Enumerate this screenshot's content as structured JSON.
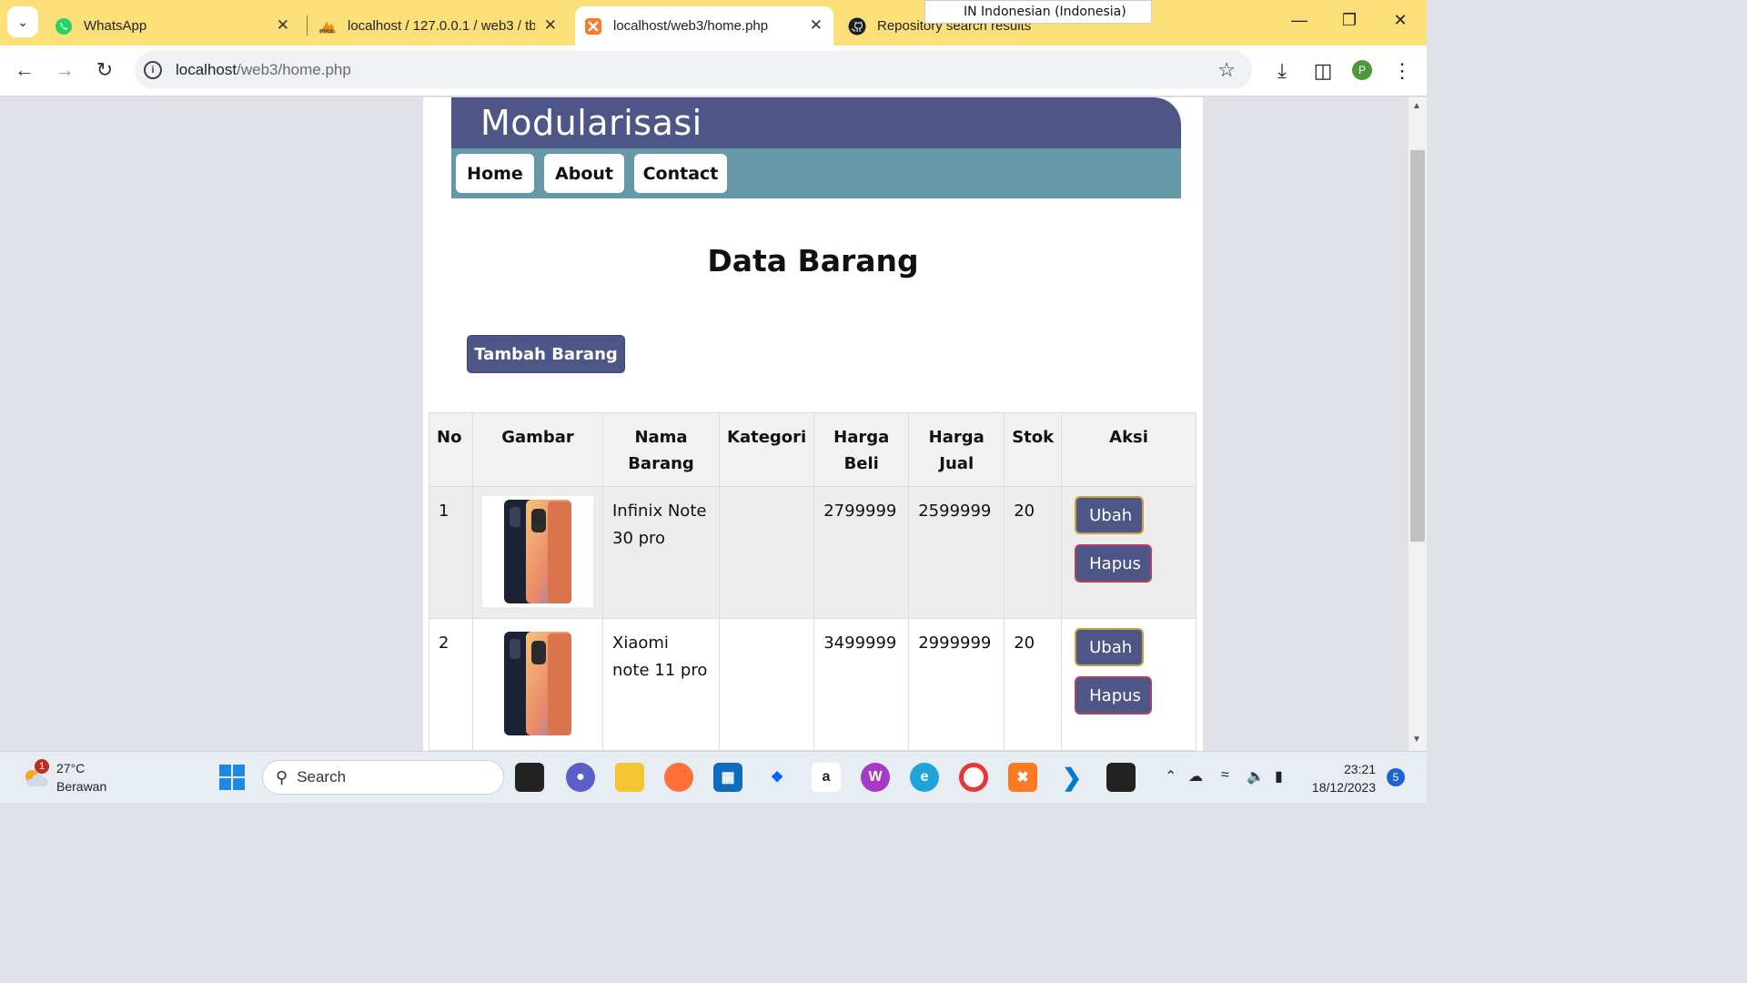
{
  "browser": {
    "tabs": [
      {
        "title": "WhatsApp",
        "icon": "whatsapp-icon"
      },
      {
        "title": "localhost / 127.0.0.1 / web3 / tb",
        "icon": "phpmyadmin-icon"
      },
      {
        "title": "localhost/web3/home.php",
        "icon": "xampp-icon",
        "active": true
      },
      {
        "title": "Repository search results",
        "icon": "github-icon"
      }
    ],
    "language_popup": "IN  Indonesian (Indonesia)",
    "url_host": "localhost",
    "url_path": "/web3/home.php",
    "profile_initial": "P"
  },
  "site": {
    "header_title": "Modularisasi",
    "nav": [
      "Home",
      "About",
      "Contact"
    ],
    "page_title": "Data Barang",
    "add_button": "Tambah Barang",
    "accent_color": "#4e5587",
    "nav_color": "#6699a8"
  },
  "table": {
    "headers": [
      "No",
      "Gambar",
      "Nama Barang",
      "Kategori",
      "Harga Beli",
      "Harga Jual",
      "Stok",
      "Aksi"
    ],
    "rows": [
      {
        "no": "1",
        "nama": "Infinix Note 30 pro",
        "kategori": "",
        "harga_beli": "2799999",
        "harga_jual": "2599999",
        "stok": "20"
      },
      {
        "no": "2",
        "nama": "Xiaomi note 11 pro",
        "kategori": "",
        "harga_beli": "3499999",
        "harga_jual": "2999999",
        "stok": "20"
      }
    ],
    "edit_label": "Ubah",
    "delete_label": "Hapus"
  },
  "taskbar": {
    "temperature": "27°C",
    "weather": "Berawan",
    "weather_badge": "1",
    "search_placeholder": "Search",
    "time": "23:21",
    "date": "18/12/2023",
    "notification_count": "5"
  }
}
